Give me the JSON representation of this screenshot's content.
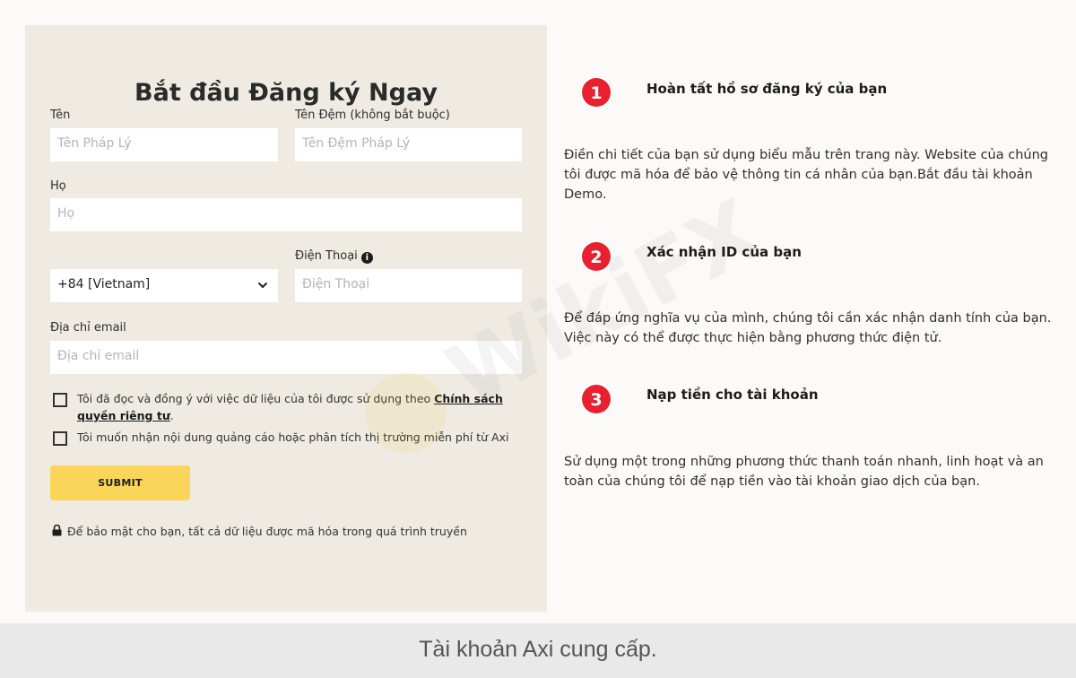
{
  "form": {
    "title": "Bắt đầu Đăng ký Ngay",
    "first_name": {
      "label": "Tên",
      "placeholder": "Tên Pháp Lý"
    },
    "middle_name": {
      "label": "Tên Đệm (không bắt buộc)",
      "placeholder": "Tên Đệm Pháp Lý"
    },
    "last_name": {
      "label": "Họ",
      "placeholder": "Họ"
    },
    "country_code": {
      "value": "+84 [Vietnam]"
    },
    "phone": {
      "label": "Điện Thoại",
      "placeholder": "Điện Thoại",
      "info_icon": "info-icon"
    },
    "email": {
      "label": "Địa chỉ email",
      "placeholder": "Địa chỉ email"
    },
    "consent_privacy": {
      "text": "Tôi đã đọc và đồng ý với việc dữ liệu của tôi được sử dụng theo ",
      "link": "Chính sách quyền riêng tư",
      "suffix": "."
    },
    "consent_marketing": {
      "text": "Tôi muốn nhận nội dung quảng cáo hoặc phân tích thị trường miễn phí từ Axi"
    },
    "submit_label": "SUBMIT",
    "security_note": "Để bảo mật cho bạn, tất cả dữ liệu được mã hóa trong quá trình truyền",
    "lock_icon": "lock-icon"
  },
  "steps": [
    {
      "number": "1",
      "title": "Hoàn tất hồ sơ đăng ký của bạn",
      "description": "Điền chi tiết của bạn sử dụng biểu mẫu trên trang này. Website của chúng tôi được mã hóa để bảo vệ thông tin cá nhân của bạn.Bắt đầu tài khoản Demo."
    },
    {
      "number": "2",
      "title": "Xác nhận ID của bạn",
      "description": "Để đáp ứng nghĩa vụ của mình, chúng tôi cần xác nhận danh tính của bạn. Việc này có thể được thực hiện bằng phương thức điện tử."
    },
    {
      "number": "3",
      "title": "Nạp tiền cho tài khoản",
      "description": "Sử dụng một trong những phương thức thanh toán nhanh, linh hoạt và an toàn của chúng tôi để nạp tiền vào tài khoản giao dịch của bạn."
    }
  ],
  "watermark": {
    "text": "WikiFX"
  },
  "caption": "Tài khoản Axi cung cấp.",
  "colors": {
    "panel_bg": "#efebe3",
    "submit_bg": "#fbd55a",
    "step_badge": "#e8202f",
    "caption_bg": "#e9e9e9"
  }
}
